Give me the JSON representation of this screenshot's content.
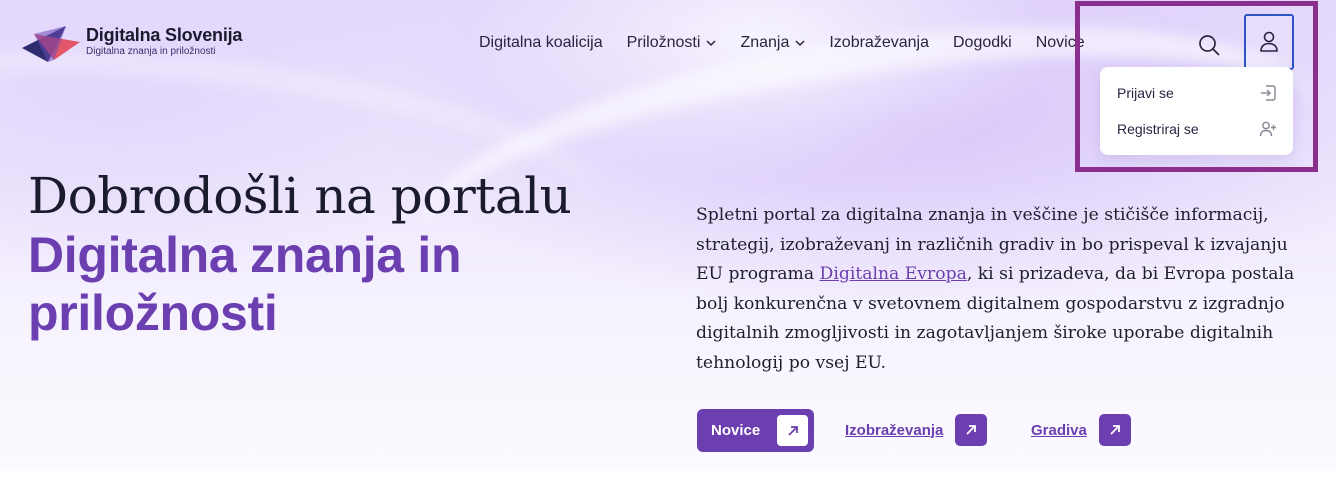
{
  "brand": {
    "title": "Digitalna Slovenija",
    "subtitle": "Digitalna znanja in priložnosti",
    "colors": {
      "accent": "#6b3fb0",
      "dark": "#1b1b2e",
      "logo_red": "#e0404f",
      "logo_navy": "#2b2d6e"
    }
  },
  "nav": {
    "items": [
      {
        "label": "Digitalna koalicija",
        "has_dropdown": false
      },
      {
        "label": "Priložnosti",
        "has_dropdown": true,
        "icon": "chevron-down-icon"
      },
      {
        "label": "Znanja",
        "has_dropdown": true,
        "icon": "chevron-down-icon"
      },
      {
        "label": "Izobraževanja",
        "has_dropdown": false
      },
      {
        "label": "Dogodki",
        "has_dropdown": false
      },
      {
        "label": "Novice",
        "has_dropdown": false
      }
    ],
    "search_icon": "search-icon",
    "user_icon": "user-icon",
    "user_menu": {
      "open": true,
      "items": [
        {
          "label": "Prijavi se",
          "icon": "login-icon"
        },
        {
          "label": "Registriraj se",
          "icon": "user-plus-icon"
        }
      ]
    },
    "highlight_color": "#8b2f8f"
  },
  "hero": {
    "title_line1": "Dobrodošli na portalu",
    "title_line2": "Digitalna znanja in priložnosti",
    "description": {
      "before_link": "Spletni portal za digitalna znanja in veščine je stičišče informacij, strategij, izobraževanj in različnih gradiv in bo prispeval k izvajanju EU programa ",
      "link": "Digitalna Evropa",
      "after_link": ", ki si prizadeva, da bi Evropa postala bolj konkurenčna v svetovnem digitalnem gospodarstvu z izgradnjo digitalnih zmogljivosti in zagotavljanjem široke uporabe digitalnih tehnologij po vsej EU."
    },
    "actions": [
      {
        "label": "Novice",
        "style": "primary",
        "icon": "arrow-up-right-icon"
      },
      {
        "label": "Izobraževanja",
        "style": "link",
        "icon": "arrow-up-right-icon"
      },
      {
        "label": "Gradiva",
        "style": "link",
        "icon": "arrow-up-right-icon"
      }
    ]
  }
}
